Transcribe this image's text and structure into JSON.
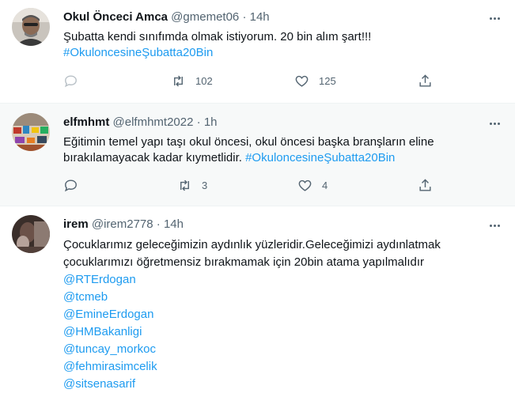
{
  "tweets": [
    {
      "name": "Okul Önceci Amca",
      "handle": "@gmemet06",
      "dot": "·",
      "time": "14h",
      "text": "Şubatta kendi sınıfımda olmak istiyorum. 20 bin alım şart!!!",
      "hashtag": "#OkuloncesineŞubatta20Bin",
      "retweets": "102",
      "likes": "125"
    },
    {
      "name": "elfmhmt",
      "handle": "@elfmhmt2022",
      "dot": "·",
      "time": "1h",
      "text_line1": "Eğitimin temel yapı taşı okul öncesi, okul öncesi başka branşların eline",
      "text_line2": "bırakılamayacak kadar kıymetlidir.",
      "hashtag": "#OkuloncesineŞubatta20Bin",
      "retweets": "3",
      "likes": "4"
    },
    {
      "name": "irem",
      "handle": "@irem2778",
      "dot": "·",
      "time": "14h",
      "text_line1": "Çocuklarımız geleceğimizin aydınlık yüzleridir.Geleceğimizi aydınlatmak",
      "text_line2": "çocuklarımızı öğretmensiz bırakmamak için 20bin atama yapılmalıdır",
      "mentions": [
        "@RTErdogan",
        "@tcmeb",
        "@EmineErdogan",
        "@HMBakanligi",
        "@tuncay_morkoc",
        "@fehmirasimcelik",
        "@sitsenasarif"
      ]
    }
  ],
  "icons": {
    "reply": "reply-icon",
    "retweet": "retweet-icon",
    "like": "heart-icon",
    "share": "share-icon",
    "more": "more-icon"
  },
  "colors": {
    "link": "#1d9bf0",
    "secondary": "#536471",
    "text": "#0f1419",
    "hover_bg": "#f7f9f9"
  }
}
